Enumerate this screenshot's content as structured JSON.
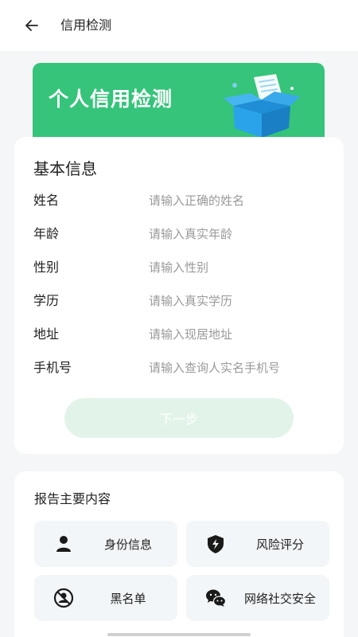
{
  "header": {
    "title": "信用检测"
  },
  "banner": {
    "title": "个人信用检测"
  },
  "basic_info": {
    "title": "基本信息",
    "fields": [
      {
        "label": "姓名",
        "placeholder": "请输入正确的姓名"
      },
      {
        "label": "年龄",
        "placeholder": "请输入真实年龄"
      },
      {
        "label": "性别",
        "placeholder": "请输入性别"
      },
      {
        "label": "学历",
        "placeholder": "请输入真实学历"
      },
      {
        "label": "地址",
        "placeholder": "请输入现居地址"
      },
      {
        "label": "手机号",
        "placeholder": "请输入查询人实名手机号"
      }
    ],
    "next_label": "下一步"
  },
  "report": {
    "title": "报告主要内容",
    "items": [
      {
        "label": "身份信息",
        "icon": "person-icon"
      },
      {
        "label": "风险评分",
        "icon": "shield-bolt-icon"
      },
      {
        "label": "黑名单",
        "icon": "blocked-user-icon"
      },
      {
        "label": "网络社交安全",
        "icon": "wechat-icon"
      }
    ]
  },
  "colors": {
    "accent": "#35c47a",
    "button_disabled": "#e2f4e9"
  }
}
